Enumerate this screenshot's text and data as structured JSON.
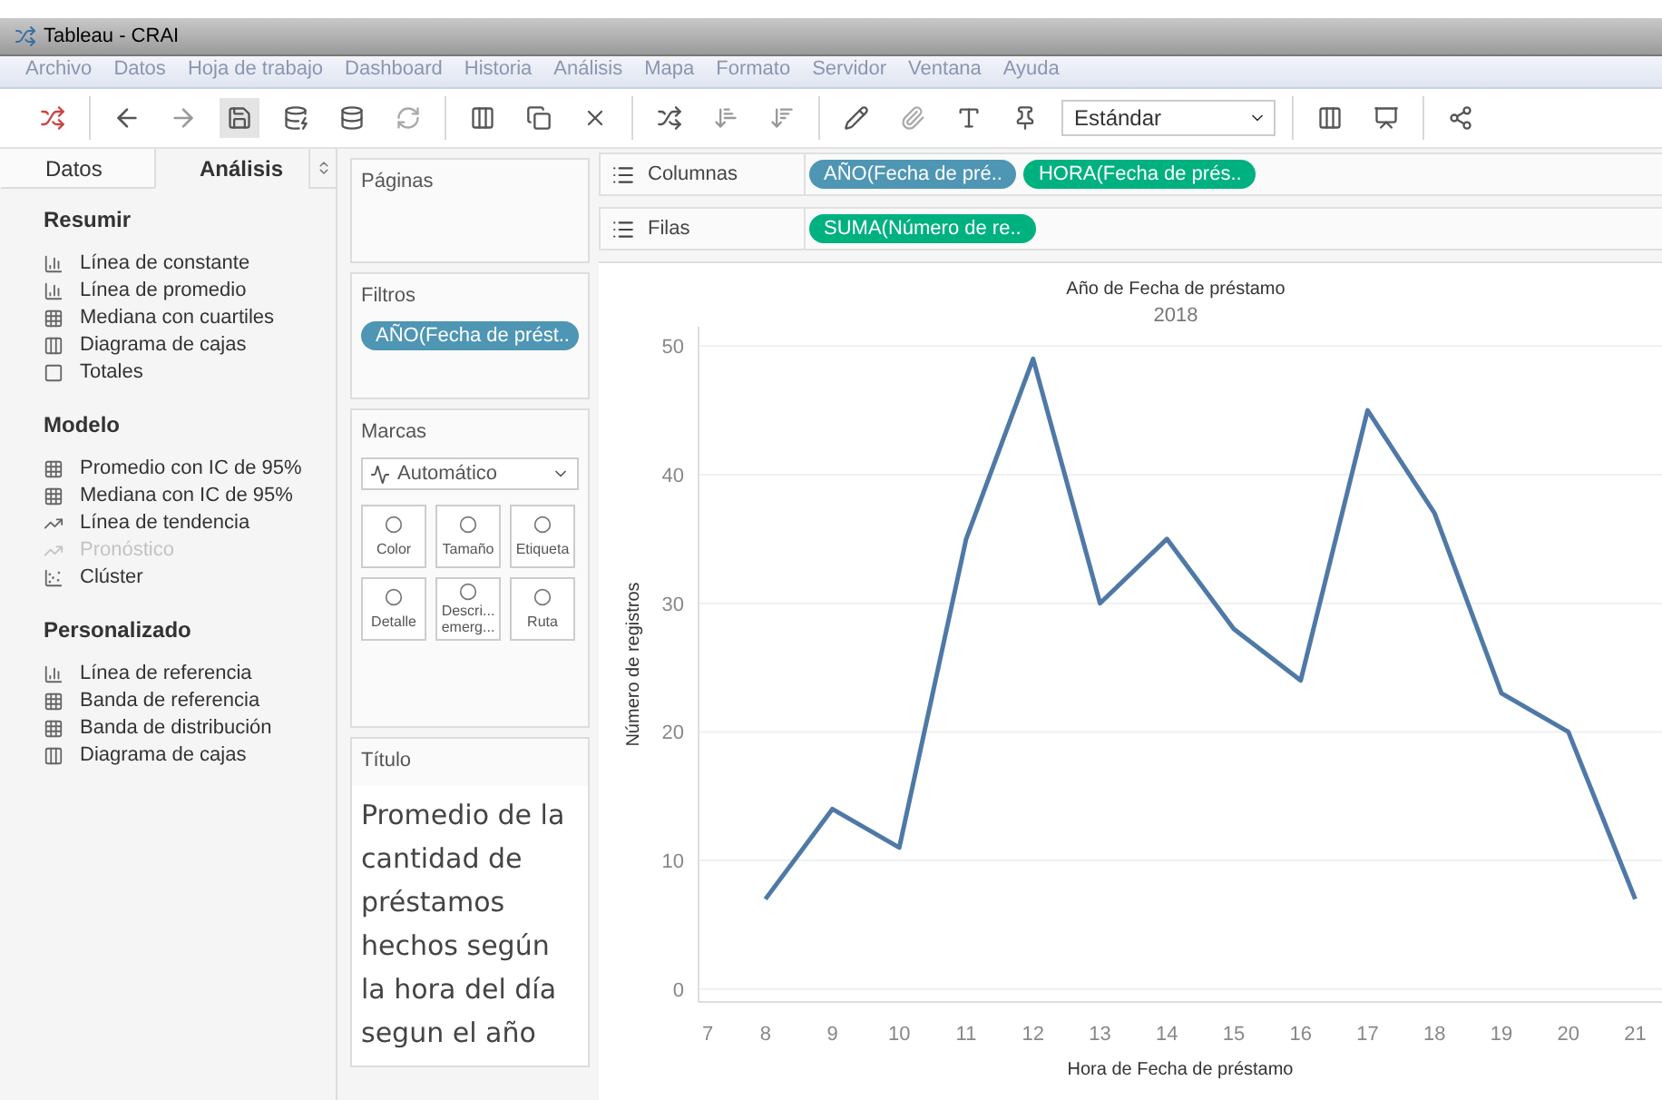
{
  "window": {
    "title": "Tableau - CRAI"
  },
  "menu": [
    "Archivo",
    "Datos",
    "Hoja de trabajo",
    "Dashboard",
    "Historia",
    "Análisis",
    "Mapa",
    "Formato",
    "Servidor",
    "Ventana",
    "Ayuda"
  ],
  "toolbar": {
    "fit_select": "Estándar"
  },
  "side_tabs": [
    {
      "label": "Datos",
      "selected": false
    },
    {
      "label": "Análisis",
      "selected": true
    }
  ],
  "analysis_sections": [
    {
      "title": "Resumir",
      "items": [
        {
          "label": "Línea de constante",
          "disabled": false
        },
        {
          "label": "Línea de promedio",
          "disabled": false
        },
        {
          "label": "Mediana con cuartiles",
          "disabled": false
        },
        {
          "label": "Diagrama de cajas",
          "disabled": false
        },
        {
          "label": "Totales",
          "disabled": false
        }
      ]
    },
    {
      "title": "Modelo",
      "items": [
        {
          "label": "Promedio con IC de 95%",
          "disabled": false
        },
        {
          "label": "Mediana con IC de 95%",
          "disabled": false
        },
        {
          "label": "Línea de tendencia",
          "disabled": false
        },
        {
          "label": "Pronóstico",
          "disabled": true
        },
        {
          "label": "Clúster",
          "disabled": false
        }
      ]
    },
    {
      "title": "Personalizado",
      "items": [
        {
          "label": "Línea de referencia",
          "disabled": false
        },
        {
          "label": "Banda de referencia",
          "disabled": false
        },
        {
          "label": "Banda de distribución",
          "disabled": false
        },
        {
          "label": "Diagrama de cajas",
          "disabled": false
        }
      ]
    }
  ],
  "pages_card": {
    "title": "Páginas"
  },
  "filters_card": {
    "title": "Filtros",
    "pills": [
      {
        "label": "AÑO(Fecha de prést..",
        "color": "#4e96b4"
      }
    ]
  },
  "marks_card": {
    "title": "Marcas",
    "mark_type": "Automático",
    "buttons": [
      "Color",
      "Tamaño",
      "Etiqueta",
      "Detalle",
      "Descri... emerg...",
      "Ruta"
    ]
  },
  "title_card": {
    "title": "Título",
    "text": "Promedio de la cantidad de préstamos hechos según la hora del día segun el año"
  },
  "shelves": [
    {
      "label": "Columnas",
      "pills": [
        {
          "label": "AÑO(Fecha de pré..",
          "color": "#4e96b4"
        },
        {
          "label": "HORA(Fecha de prés..",
          "color": "#00b180"
        }
      ]
    },
    {
      "label": "Filas",
      "pills": [
        {
          "label": "SUMA(Número de re..",
          "color": "#00b180"
        }
      ]
    }
  ],
  "view": {
    "header_title": "Año de Fecha de préstamo",
    "header_value": "2018",
    "chart_data": {
      "type": "line",
      "xlabel": "Hora de Fecha de préstamo",
      "ylabel": "Número de registros",
      "x": [
        8,
        9,
        10,
        11,
        12,
        13,
        14,
        15,
        16,
        17,
        18,
        19,
        20,
        21
      ],
      "grid": true,
      "series": [
        {
          "color": "#4e79a7",
          "values": [
            7,
            14,
            11,
            35,
            49,
            30,
            35,
            28,
            24,
            45,
            37,
            23,
            20,
            7
          ]
        }
      ],
      "xlim": [
        7,
        21.4
      ],
      "ylim": [
        -1,
        51.5
      ],
      "xticks": [
        7,
        8,
        9,
        10,
        11,
        12,
        13,
        14,
        15,
        16,
        17,
        18,
        19,
        20,
        21
      ],
      "yticks": [
        0,
        10,
        20,
        30,
        40,
        50
      ]
    }
  }
}
